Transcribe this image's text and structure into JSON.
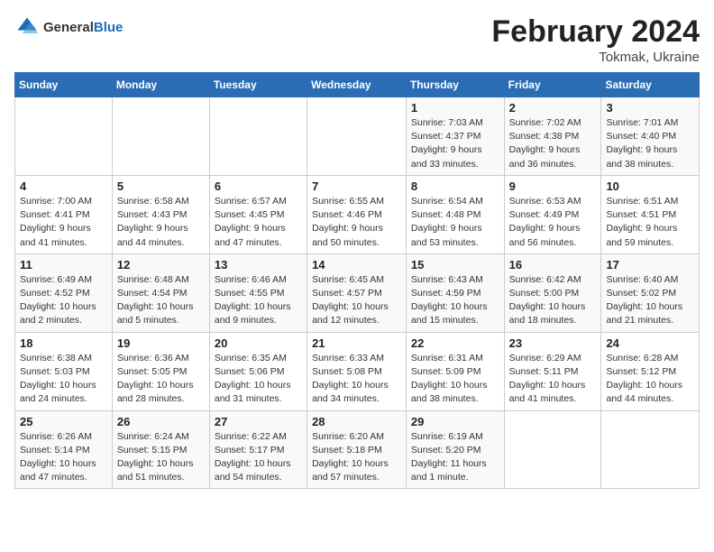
{
  "header": {
    "logo_general": "General",
    "logo_blue": "Blue",
    "month_title": "February 2024",
    "subtitle": "Tokmak, Ukraine"
  },
  "columns": [
    "Sunday",
    "Monday",
    "Tuesday",
    "Wednesday",
    "Thursday",
    "Friday",
    "Saturday"
  ],
  "weeks": [
    [
      {
        "day": "",
        "info": ""
      },
      {
        "day": "",
        "info": ""
      },
      {
        "day": "",
        "info": ""
      },
      {
        "day": "",
        "info": ""
      },
      {
        "day": "1",
        "info": "Sunrise: 7:03 AM\nSunset: 4:37 PM\nDaylight: 9 hours\nand 33 minutes."
      },
      {
        "day": "2",
        "info": "Sunrise: 7:02 AM\nSunset: 4:38 PM\nDaylight: 9 hours\nand 36 minutes."
      },
      {
        "day": "3",
        "info": "Sunrise: 7:01 AM\nSunset: 4:40 PM\nDaylight: 9 hours\nand 38 minutes."
      }
    ],
    [
      {
        "day": "4",
        "info": "Sunrise: 7:00 AM\nSunset: 4:41 PM\nDaylight: 9 hours\nand 41 minutes."
      },
      {
        "day": "5",
        "info": "Sunrise: 6:58 AM\nSunset: 4:43 PM\nDaylight: 9 hours\nand 44 minutes."
      },
      {
        "day": "6",
        "info": "Sunrise: 6:57 AM\nSunset: 4:45 PM\nDaylight: 9 hours\nand 47 minutes."
      },
      {
        "day": "7",
        "info": "Sunrise: 6:55 AM\nSunset: 4:46 PM\nDaylight: 9 hours\nand 50 minutes."
      },
      {
        "day": "8",
        "info": "Sunrise: 6:54 AM\nSunset: 4:48 PM\nDaylight: 9 hours\nand 53 minutes."
      },
      {
        "day": "9",
        "info": "Sunrise: 6:53 AM\nSunset: 4:49 PM\nDaylight: 9 hours\nand 56 minutes."
      },
      {
        "day": "10",
        "info": "Sunrise: 6:51 AM\nSunset: 4:51 PM\nDaylight: 9 hours\nand 59 minutes."
      }
    ],
    [
      {
        "day": "11",
        "info": "Sunrise: 6:49 AM\nSunset: 4:52 PM\nDaylight: 10 hours\nand 2 minutes."
      },
      {
        "day": "12",
        "info": "Sunrise: 6:48 AM\nSunset: 4:54 PM\nDaylight: 10 hours\nand 5 minutes."
      },
      {
        "day": "13",
        "info": "Sunrise: 6:46 AM\nSunset: 4:55 PM\nDaylight: 10 hours\nand 9 minutes."
      },
      {
        "day": "14",
        "info": "Sunrise: 6:45 AM\nSunset: 4:57 PM\nDaylight: 10 hours\nand 12 minutes."
      },
      {
        "day": "15",
        "info": "Sunrise: 6:43 AM\nSunset: 4:59 PM\nDaylight: 10 hours\nand 15 minutes."
      },
      {
        "day": "16",
        "info": "Sunrise: 6:42 AM\nSunset: 5:00 PM\nDaylight: 10 hours\nand 18 minutes."
      },
      {
        "day": "17",
        "info": "Sunrise: 6:40 AM\nSunset: 5:02 PM\nDaylight: 10 hours\nand 21 minutes."
      }
    ],
    [
      {
        "day": "18",
        "info": "Sunrise: 6:38 AM\nSunset: 5:03 PM\nDaylight: 10 hours\nand 24 minutes."
      },
      {
        "day": "19",
        "info": "Sunrise: 6:36 AM\nSunset: 5:05 PM\nDaylight: 10 hours\nand 28 minutes."
      },
      {
        "day": "20",
        "info": "Sunrise: 6:35 AM\nSunset: 5:06 PM\nDaylight: 10 hours\nand 31 minutes."
      },
      {
        "day": "21",
        "info": "Sunrise: 6:33 AM\nSunset: 5:08 PM\nDaylight: 10 hours\nand 34 minutes."
      },
      {
        "day": "22",
        "info": "Sunrise: 6:31 AM\nSunset: 5:09 PM\nDaylight: 10 hours\nand 38 minutes."
      },
      {
        "day": "23",
        "info": "Sunrise: 6:29 AM\nSunset: 5:11 PM\nDaylight: 10 hours\nand 41 minutes."
      },
      {
        "day": "24",
        "info": "Sunrise: 6:28 AM\nSunset: 5:12 PM\nDaylight: 10 hours\nand 44 minutes."
      }
    ],
    [
      {
        "day": "25",
        "info": "Sunrise: 6:26 AM\nSunset: 5:14 PM\nDaylight: 10 hours\nand 47 minutes."
      },
      {
        "day": "26",
        "info": "Sunrise: 6:24 AM\nSunset: 5:15 PM\nDaylight: 10 hours\nand 51 minutes."
      },
      {
        "day": "27",
        "info": "Sunrise: 6:22 AM\nSunset: 5:17 PM\nDaylight: 10 hours\nand 54 minutes."
      },
      {
        "day": "28",
        "info": "Sunrise: 6:20 AM\nSunset: 5:18 PM\nDaylight: 10 hours\nand 57 minutes."
      },
      {
        "day": "29",
        "info": "Sunrise: 6:19 AM\nSunset: 5:20 PM\nDaylight: 11 hours\nand 1 minute."
      },
      {
        "day": "",
        "info": ""
      },
      {
        "day": "",
        "info": ""
      }
    ]
  ]
}
